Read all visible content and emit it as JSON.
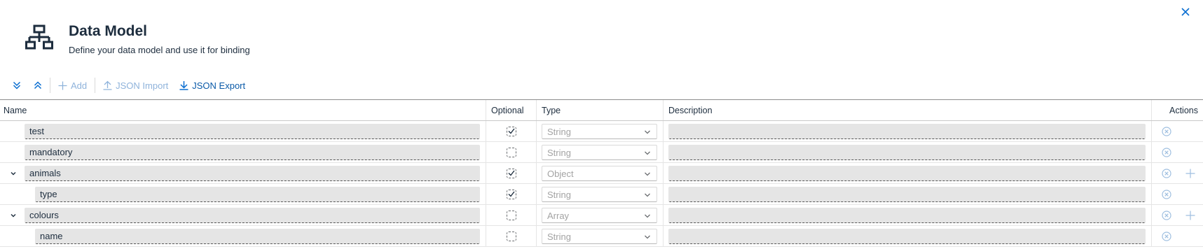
{
  "dialog": {
    "title": "Data Model",
    "subtitle": "Define your data model and use it for binding",
    "header_icon": "hierarchy-icon",
    "close_icon": "close-icon"
  },
  "toolbar": {
    "expand_all_icon": "expand-all-icon",
    "collapse_all_icon": "collapse-all-icon",
    "add_label": "Add",
    "add_enabled": false,
    "json_import_label": "JSON Import",
    "json_import_enabled": false,
    "json_export_label": "JSON Export",
    "json_export_enabled": true
  },
  "table": {
    "headers": {
      "name": "Name",
      "optional": "Optional",
      "type": "Type",
      "description": "Description",
      "actions": "Actions"
    },
    "rows": [
      {
        "name": "test",
        "level": 0,
        "expandable": false,
        "optional": true,
        "type": "String",
        "description": "",
        "can_add_child": false
      },
      {
        "name": "mandatory",
        "level": 0,
        "expandable": false,
        "optional": false,
        "type": "String",
        "description": "",
        "can_add_child": false
      },
      {
        "name": "animals",
        "level": 0,
        "expandable": true,
        "expanded": true,
        "optional": true,
        "type": "Object",
        "description": "",
        "can_add_child": true
      },
      {
        "name": "type",
        "level": 1,
        "expandable": false,
        "optional": true,
        "type": "String",
        "description": "",
        "can_add_child": false
      },
      {
        "name": "colours",
        "level": 0,
        "expandable": true,
        "expanded": true,
        "optional": false,
        "type": "Array",
        "description": "",
        "can_add_child": true
      },
      {
        "name": "name",
        "level": 1,
        "expandable": false,
        "optional": false,
        "type": "String",
        "description": "",
        "can_add_child": false
      }
    ]
  },
  "colors": {
    "accent": "#0a6ed1",
    "disabled_accent": "#8fb3db",
    "input_background": "#e5e5e5",
    "action_icon": "#9fbfe0"
  }
}
